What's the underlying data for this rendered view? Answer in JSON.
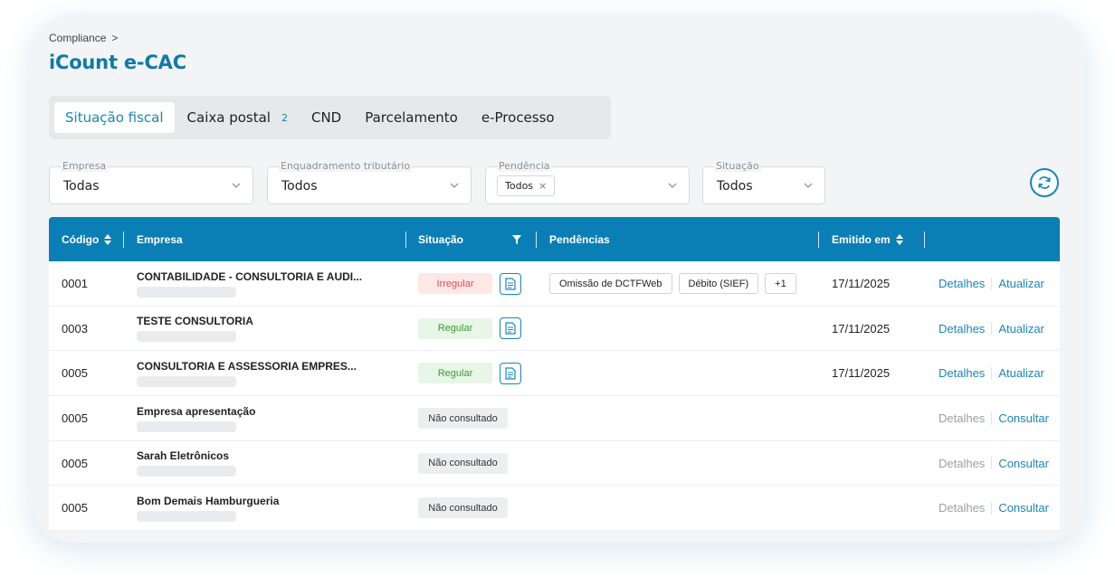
{
  "breadcrumb": {
    "item": "Compliance",
    "separator": ">"
  },
  "title": "iCount e-CAC",
  "tabs": [
    {
      "label": "Situação fiscal",
      "active": true
    },
    {
      "label": "Caixa postal",
      "count": "2"
    },
    {
      "label": "CND"
    },
    {
      "label": "Parcelamento"
    },
    {
      "label": "e-Processo"
    }
  ],
  "filters": {
    "empresa": {
      "label": "Empresa",
      "value": "Todas"
    },
    "enquadramento": {
      "label": "Enquadramento tributário",
      "value": "Todos"
    },
    "pendencia": {
      "label": "Pendência",
      "chip": "Todos",
      "chip_remove": "×"
    },
    "situacao": {
      "label": "Situação",
      "value": "Todos"
    }
  },
  "refresh_icon": "refresh-icon",
  "table": {
    "headers": {
      "codigo": "Código",
      "empresa": "Empresa",
      "situacao": "Situação",
      "pendencias": "Pendências",
      "emitido": "Emitido em"
    },
    "rows": [
      {
        "codigo": "0001",
        "empresa": "CONTABILIDADE - CONSULTORIA E AUDI...",
        "situacao": "Irregular",
        "status": "irregular",
        "pendencias": [
          "Omissão de DCTFWeb",
          "Débito (SIEF)",
          "+1"
        ],
        "emitido": "17/11/2025",
        "detalhes": "Detalhes",
        "acao": "Atualizar"
      },
      {
        "codigo": "0003",
        "empresa": "TESTE CONSULTORIA",
        "situacao": "Regular",
        "status": "regular",
        "pendencias": [],
        "emitido": "17/11/2025",
        "detalhes": "Detalhes",
        "acao": "Atualizar"
      },
      {
        "codigo": "0005",
        "empresa": "CONSULTORIA E ASSESSORIA EMPRES...",
        "situacao": "Regular",
        "status": "regular",
        "pendencias": [],
        "emitido": "17/11/2025",
        "detalhes": "Detalhes",
        "acao": "Atualizar"
      },
      {
        "codigo": "0005",
        "empresa": "Empresa apresentação",
        "situacao": "Não consultado",
        "status": "nc",
        "pendencias": [],
        "emitido": "",
        "detalhes": "Detalhes",
        "acao": "Consultar"
      },
      {
        "codigo": "0005",
        "empresa": "Sarah Eletrônicos",
        "situacao": "Não consultado",
        "status": "nc",
        "pendencias": [],
        "emitido": "",
        "detalhes": "Detalhes",
        "acao": "Consultar"
      },
      {
        "codigo": "0005",
        "empresa": "Bom Demais Hamburgueria",
        "situacao": "Não consultado",
        "status": "nc",
        "pendencias": [],
        "emitido": "",
        "detalhes": "Detalhes",
        "acao": "Consultar"
      }
    ]
  },
  "colors": {
    "primary": "#0a7fb5",
    "accent": "#1a86b8",
    "irregular": "#e04e4e",
    "regular": "#3e9a3b"
  }
}
